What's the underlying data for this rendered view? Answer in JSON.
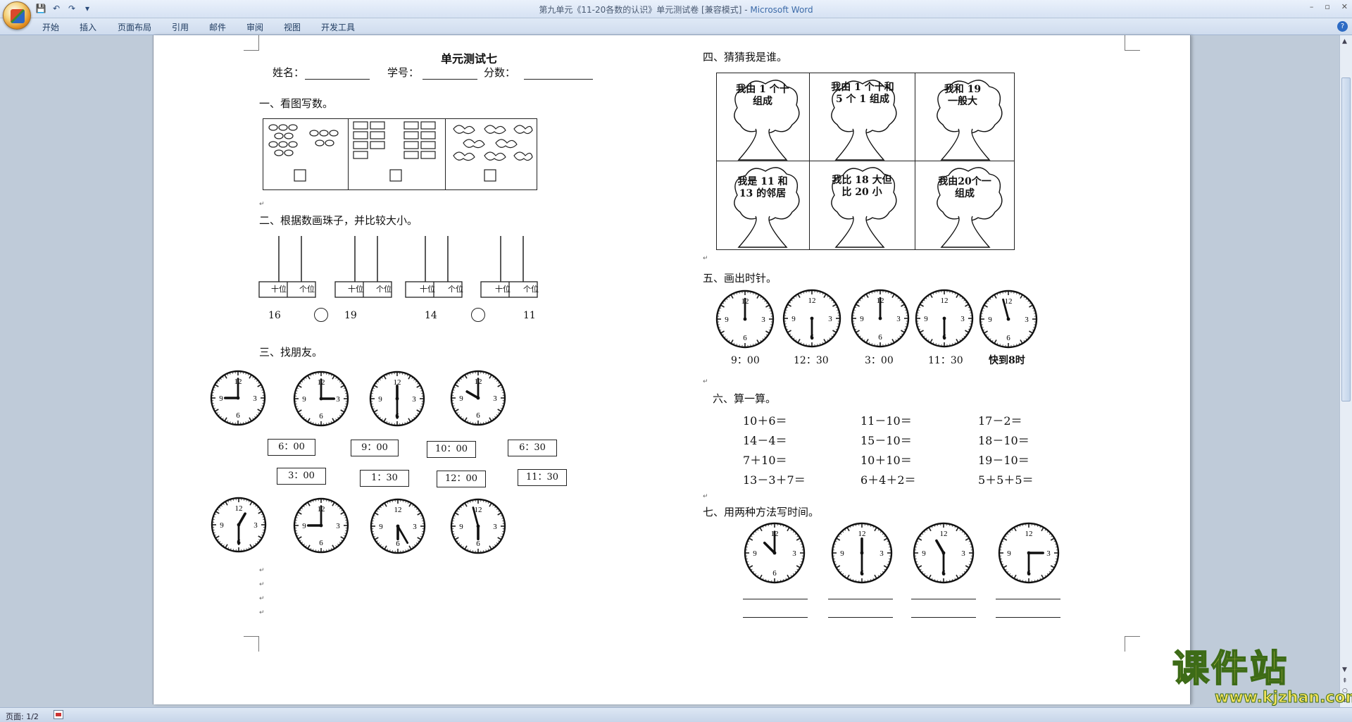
{
  "window": {
    "title": "第九单元《11-20各数的认识》单元测试卷 [兼容模式] - ",
    "app_name": "Microsoft Word",
    "quick_access": [
      "save-icon",
      "undo-icon",
      "redo-icon",
      "customize-icon"
    ]
  },
  "ribbon": {
    "tabs": [
      "开始",
      "插入",
      "页面布局",
      "引用",
      "邮件",
      "审阅",
      "视图",
      "开发工具"
    ]
  },
  "status": {
    "page": "页面: 1/2"
  },
  "watermark": {
    "main": "课件站",
    "url": "www.kjzhan.com"
  },
  "doc": {
    "title": "单元测试七",
    "name_label": "姓名：",
    "id_label": "学号：",
    "score_label": "分数：",
    "s1": "一、看图写数。",
    "s2": "二、根据数画珠子，并比较大小。",
    "s3": "三、找朋友。",
    "s4": "四、猜猜我是谁。",
    "s5": "五、画出时针。",
    "s6": "六、算一算。",
    "s7": "七、用两种方法写时间。",
    "place_tens": "十位",
    "place_ones": "个位",
    "bead_numbers": [
      "16",
      "19",
      "14",
      "11"
    ],
    "friend_times_row1": [
      "6：00",
      "9：00",
      "10：00",
      "6：30"
    ],
    "friend_times_row2": [
      "3：00",
      "1：30",
      "12：00",
      "11：30"
    ],
    "riddles": [
      "我由 1 个十组成",
      "我由 1 个十和 5 个 1 组成",
      "我和 19 一般大",
      "我是 11 和 13 的邻居",
      "我比 18 大但比 20 小",
      "我由20个一组成"
    ],
    "clock_times": [
      "9：00",
      "12：30",
      "3：00",
      "11：30",
      "快到8时"
    ],
    "calc": [
      [
        "10＋6＝",
        "11－10＝",
        "17－2＝"
      ],
      [
        "14－4＝",
        "15－10＝",
        "18－10＝"
      ],
      [
        "7＋10＝",
        "10＋10＝",
        "19－10＝"
      ],
      [
        "13－3＋7＝",
        "6＋4＋2＝",
        "5＋5＋5＝"
      ]
    ],
    "clock_digits": {
      "n12": "12",
      "n3": "3",
      "n6": "6",
      "n9": "9"
    }
  }
}
